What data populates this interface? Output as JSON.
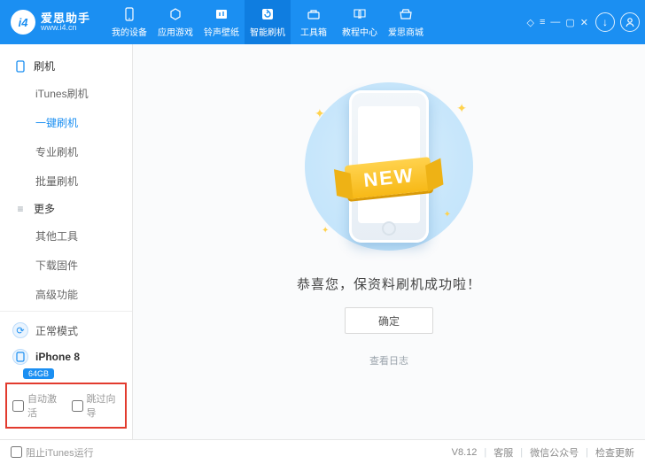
{
  "logo": {
    "badge": "i4",
    "cn": "爱思助手",
    "url": "www.i4.cn"
  },
  "nav": [
    {
      "id": "device",
      "label": "我的设备"
    },
    {
      "id": "apps",
      "label": "应用游戏"
    },
    {
      "id": "wall",
      "label": "铃声壁纸"
    },
    {
      "id": "flash",
      "label": "智能刷机",
      "active": true
    },
    {
      "id": "tools",
      "label": "工具箱"
    },
    {
      "id": "tutorial",
      "label": "教程中心"
    },
    {
      "id": "store",
      "label": "爱思商城"
    }
  ],
  "sidebar": {
    "groups": [
      {
        "icon": "phone",
        "label": "刷机",
        "items": [
          {
            "id": "itunes",
            "label": "iTunes刷机"
          },
          {
            "id": "onekey",
            "label": "一键刷机",
            "active": true
          },
          {
            "id": "pro",
            "label": "专业刷机"
          },
          {
            "id": "batch",
            "label": "批量刷机"
          }
        ]
      },
      {
        "icon": "more",
        "label": "更多",
        "items": [
          {
            "id": "other",
            "label": "其他工具"
          },
          {
            "id": "fw",
            "label": "下载固件"
          },
          {
            "id": "adv",
            "label": "高级功能"
          }
        ]
      }
    ],
    "mode": {
      "label": "正常模式"
    },
    "device": {
      "name": "iPhone 8",
      "storage": "64GB"
    },
    "checkboxes": {
      "auto": "自动激活",
      "skip": "跳过向导"
    }
  },
  "main": {
    "ribbon": "NEW",
    "message": "恭喜您，保资料刷机成功啦！",
    "ok": "确定",
    "log": "查看日志"
  },
  "footer": {
    "stop": "阻止iTunes运行",
    "ver": "V8.12",
    "support": "客服",
    "wx": "微信公众号",
    "update": "检查更新"
  }
}
